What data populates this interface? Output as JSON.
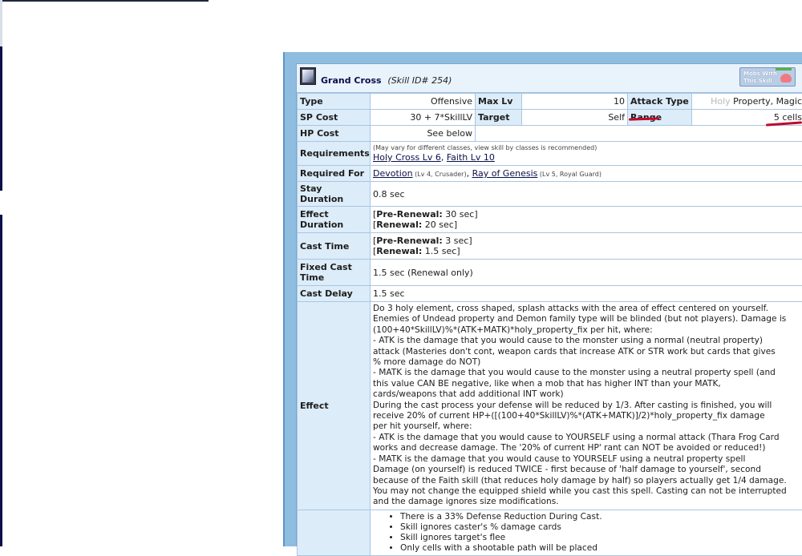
{
  "header": {
    "title": "Grand Cross",
    "skill_id": "(Skill ID# 254)",
    "mobs_button": "Mobs With This Skill"
  },
  "rows": {
    "type_label": "Type",
    "type_value": "Offensive",
    "maxlv_label": "Max Lv",
    "maxlv_value": "10",
    "attack_type_label": "Attack Type",
    "attack_type_holy": "Holy",
    "attack_type_rest": " Property, Magic",
    "sp_cost_label": "SP Cost",
    "sp_cost_value": "30 + 7*SkillLV",
    "target_label": "Target",
    "target_value": "Self",
    "range_label": "Range",
    "range_value": "5 cells",
    "hp_cost_label": "HP Cost",
    "hp_cost_value": "See below",
    "requirements_label": "Requirements",
    "requirements_note": "(May vary for different classes, view skill by classes is recommended)",
    "req_link_1": "Holy Cross Lv 6",
    "req_sep": ", ",
    "req_link_2": "Faith Lv 10",
    "required_for_label": "Required For",
    "rf_link_1": "Devotion",
    "rf_note_1": " (Lv 4, Crusader)",
    "rf_sep": ", ",
    "rf_link_2": "Ray of Genesis",
    "rf_note_2": " (Lv 5, Royal Guard)",
    "stay_label": "Stay Duration",
    "stay_value": "0.8 sec",
    "effect_duration_label": "Effect Duration",
    "ed_pre_label": "Pre-Renewal:",
    "ed_pre_value": " 30 sec",
    "ed_ren_label": "Renewal:",
    "ed_ren_value": " 20 sec",
    "cast_time_label": "Cast Time",
    "ct_pre_label": "Pre-Renewal:",
    "ct_pre_value": " 3 sec",
    "ct_ren_label": "Renewal:",
    "ct_ren_value": " 1.5 sec",
    "fixed_cast_label": "Fixed Cast Time",
    "fixed_cast_value": "1.5 sec (Renewal only)",
    "cast_delay_label": "Cast Delay",
    "cast_delay_value": "1.5 sec",
    "effect_label": "Effect"
  },
  "effect_lines": [
    "Do 3 holy element, cross shaped, splash attacks with the area of effect centered on yourself.",
    "Enemies of Undead property and Demon family type will be blinded (but not players). Damage is",
    "(100+40*SkillLV)%*(ATK+MATK)*holy_property_fix per hit, where:",
    "- ATK is the damage that you would cause to the monster using a normal (neutral property)",
    "attack (Masteries don't cont, weapon cards that increase ATK or STR work but cards that gives",
    "% more damage do NOT)",
    "- MATK is the damage that you would cause to the monster using a neutral property spell (and",
    "this value CAN BE negative, like when a mob that has higher INT than your MATK,",
    "cards/weapons that add additional INT work)",
    "During the cast process your defense will be reduced by 1/3. After casting is finished, you will",
    "receive 20% of current HP+([(100+40*SkillLV)%*(ATK+MATK)]/2)*holy_property_fix damage",
    "per hit yourself, where:",
    "- ATK is the damage that you would cause to YOURSELF using a normal attack (Thara Frog Card",
    "works and decrease damage. The '20% of current HP' rant can NOT be avoided or reduced!)",
    "- MATK is the damage that you would cause to YOURSELF using a neutral property spell",
    "Damage (on yourself) is reduced TWICE - first because of 'half damage to yourself', second",
    "because of the Faith skill (that reduces holy damage by half) so players actually get 1/4 damage.",
    "You may not change the equipped shield while you cast this spell. Casting can not be interrupted",
    "and the damage ignores size modifications."
  ],
  "notes": [
    "There is a 33% Defense Reduction During Cast.",
    "Skill ignores caster's % damage cards",
    "Skill ignores target's flee",
    "Only cells with a shootable path will be placed"
  ],
  "colors": {
    "panel": "#8fbde0",
    "label_bg": "#dcecf9",
    "label_text": "#0b0f4a",
    "annotation": "#c0092c"
  }
}
